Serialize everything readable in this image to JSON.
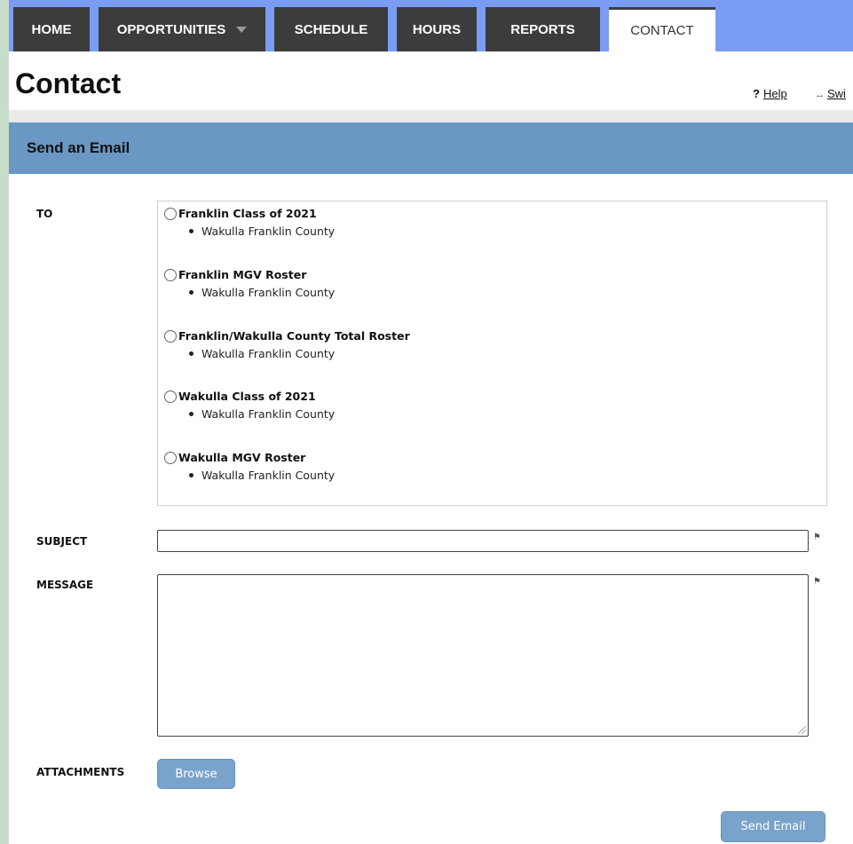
{
  "nav": {
    "tabs": [
      {
        "label": "HOME"
      },
      {
        "label": "OPPORTUNITIES"
      },
      {
        "label": "SCHEDULE"
      },
      {
        "label": "HOURS"
      },
      {
        "label": "REPORTS"
      },
      {
        "label": "CONTACT"
      }
    ],
    "active_tab": "CONTACT"
  },
  "page": {
    "title": "Contact",
    "help_icon": "?",
    "help_label": "Help",
    "switch_icon": "↔",
    "switch_label": "Swi"
  },
  "section": {
    "title": "Send an Email"
  },
  "form": {
    "to_label": "TO",
    "recipients": [
      {
        "name": "Franklin Class of 2021",
        "group": "Wakulla Franklin County",
        "selected": false
      },
      {
        "name": "Franklin MGV Roster",
        "group": "Wakulla Franklin County",
        "selected": false
      },
      {
        "name": "Franklin/Wakulla County Total Roster",
        "group": "Wakulla Franklin County",
        "selected": false
      },
      {
        "name": "Wakulla Class of 2021",
        "group": "Wakulla Franklin County",
        "selected": false
      },
      {
        "name": "Wakulla MGV Roster",
        "group": "Wakulla Franklin County",
        "selected": false
      }
    ],
    "subject_label": "SUBJECT",
    "subject_value": "",
    "message_label": "MESSAGE",
    "message_value": "",
    "attachments_label": "ATTACHMENTS",
    "browse_label": "Browse",
    "send_label": "Send Email",
    "required_icon": "flag-icon"
  },
  "colors": {
    "nav_bg": "#7a9cf2",
    "tab_bg": "#3c3c3c",
    "section_header_bg": "#6a98c3",
    "button_bg": "#7aa3cc",
    "page_border": "#c7dcc9"
  }
}
